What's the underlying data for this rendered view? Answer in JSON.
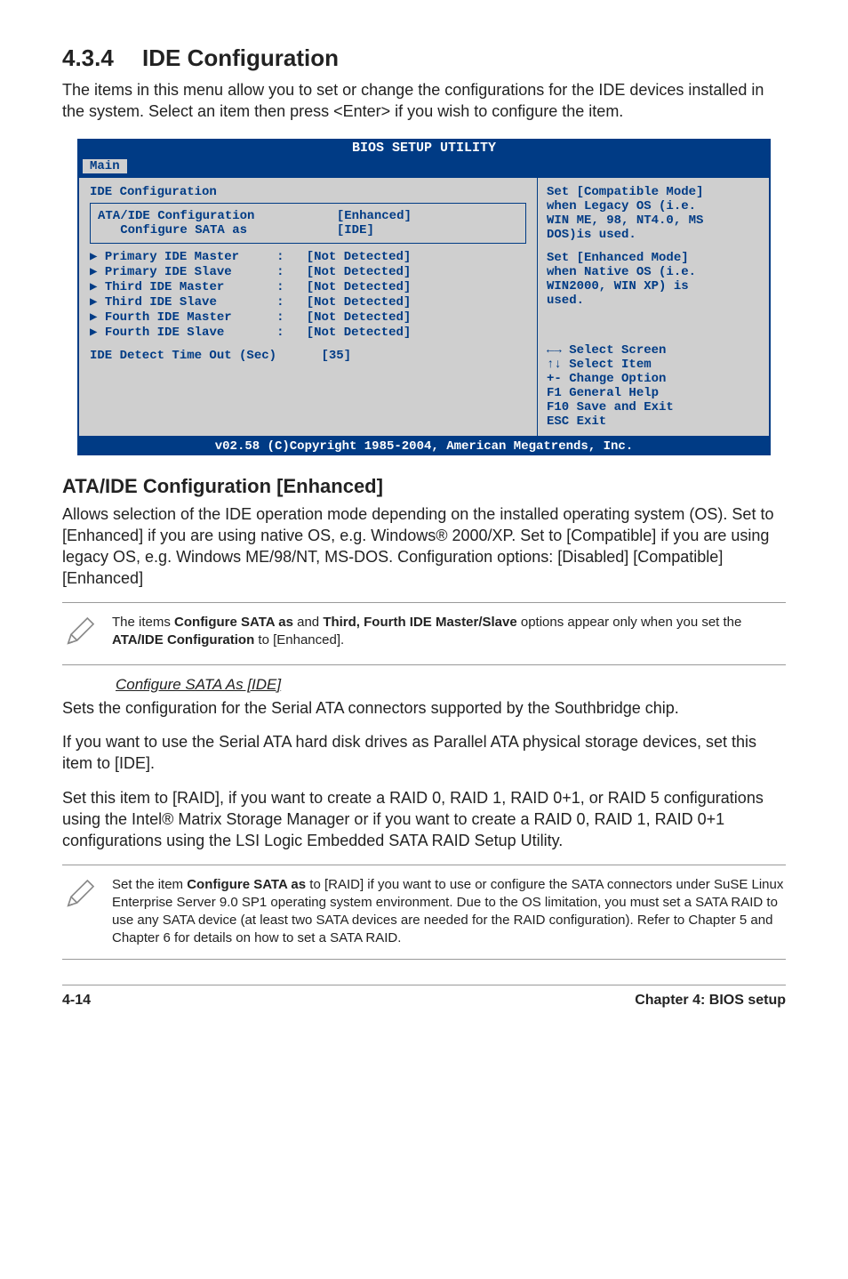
{
  "section": {
    "number": "4.3.4",
    "title": "IDE Configuration"
  },
  "intro": "The items in this menu allow you to set or change the configurations for the IDE devices installed in the system. Select an item then press <Enter> if you wish to configure the item.",
  "bios": {
    "title": "BIOS SETUP UTILITY",
    "tab": "Main",
    "header": "IDE Configuration",
    "settings": {
      "ata_label": "ATA/IDE Configuration",
      "ata_value": "[Enhanced]",
      "sata_label": "   Configure SATA as",
      "sata_value": "[IDE]"
    },
    "devices": [
      {
        "label": "Primary IDE Master",
        "value": "[Not Detected]"
      },
      {
        "label": "Primary IDE Slave",
        "value": "[Not Detected]"
      },
      {
        "label": "Third IDE Master",
        "value": "[Not Detected]"
      },
      {
        "label": "Third IDE Slave",
        "value": "[Not Detected]"
      },
      {
        "label": "Fourth IDE Master",
        "value": "[Not Detected]"
      },
      {
        "label": "Fourth IDE Slave",
        "value": "[Not Detected]"
      }
    ],
    "timeout": {
      "label": "IDE Detect Time Out (Sec)",
      "value": "[35]"
    },
    "help": {
      "l1": "Set [Compatible Mode]",
      "l2": "when Legacy OS (i.e.",
      "l3": "WIN ME, 98, NT4.0, MS",
      "l4": "DOS)is used.",
      "l5": "Set [Enhanced Mode]",
      "l6": "when Native OS (i.e.",
      "l7": "WIN2000, WIN XP) is",
      "l8": "used."
    },
    "nav": {
      "l1": "←→ Select Screen",
      "l2": "↑↓  Select Item",
      "l3": "+-  Change Option",
      "l4": "F1  General Help",
      "l5": "F10 Save and Exit",
      "l6": "ESC Exit"
    },
    "footer": "v02.58 (C)Copyright 1985-2004, American Megatrends, Inc."
  },
  "subheading1": "ATA/IDE Configuration [Enhanced]",
  "para_ata": "Allows selection of the IDE operation mode depending on the installed operating system (OS). Set to [Enhanced] if you are using native OS, e.g. Windows® 2000/XP. Set to [Compatible] if you are using legacy OS, e.g. Windows ME/98/NT, MS-DOS.  Configuration options: [Disabled] [Compatible] [Enhanced]",
  "note1": {
    "a": "The items ",
    "b": "Configure SATA as",
    "c": " and ",
    "d": "Third, Fourth IDE Master/Slave",
    "e": " options appear only when you set the ",
    "f": "ATA/IDE Configuration",
    "g": " to [Enhanced]."
  },
  "configure_sata_heading": "Configure SATA As [IDE]",
  "para_sb": "Sets the configuration for the Serial ATA connectors supported by the Southbridge chip.",
  "para_ide": "If you want to use the Serial ATA hard disk drives as Parallel ATA physical storage devices, set this item to [IDE].",
  "para_raid": "Set this item to [RAID], if you want to create a RAID 0, RAID 1, RAID 0+1, or RAID 5 configurations using the Intel® Matrix Storage Manager or if you want to create a RAID 0, RAID 1, RAID 0+1 configurations using the LSI Logic Embedded SATA RAID Setup Utility.",
  "note2": {
    "a": "Set the item ",
    "b": "Configure SATA as",
    "c": " to [RAID] if you want to use or configure the SATA connectors under SuSE Linux Enterprise Server 9.0 SP1 operating system environment. Due to the OS limitation, you must set a SATA RAID to use any SATA device (at least two SATA devices are needed for the RAID configuration). Refer to Chapter 5 and Chapter 6 for details on how to set a SATA RAID."
  },
  "footer": {
    "page": "4-14",
    "chapter": "Chapter 4: BIOS setup"
  }
}
